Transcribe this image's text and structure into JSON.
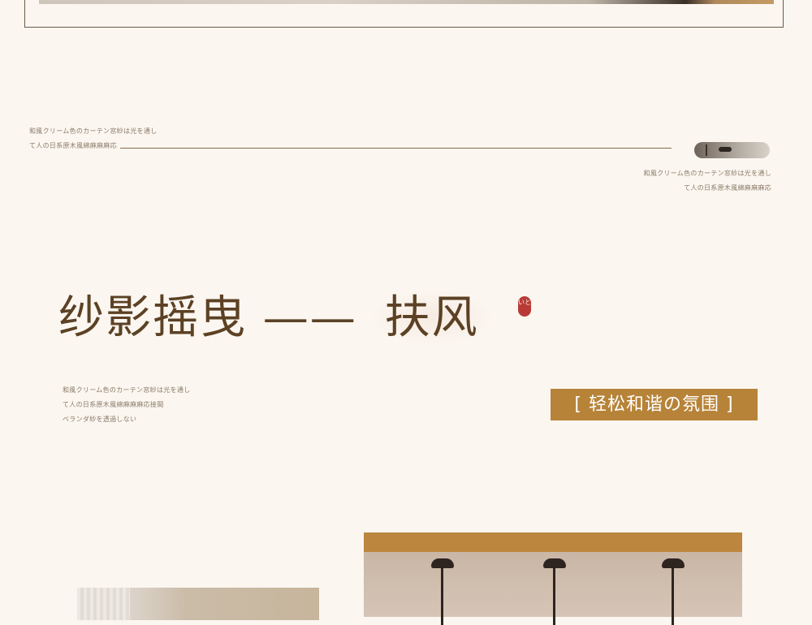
{
  "intro": {
    "left_lines": [
      "和風クリーム色のカーテン窓紗は光を通し",
      "て人の日系原木風綿麻麻麻応"
    ],
    "right_lines": [
      "和風クリーム色のカーテン窓紗は光を通し",
      "て人の日系原木風綿麻麻麻応"
    ]
  },
  "section": {
    "title_main": "纱影摇曳 —— ",
    "title_accent": "扶风",
    "seal_text": "いと",
    "description": [
      "和風クリーム色のカーテン窓紗は光を通し",
      "て人の日系原木風綿麻麻麻応接間",
      "ベランダ紗を透過しない"
    ],
    "tag": "[ 轻松和谐の氛围 ]"
  }
}
